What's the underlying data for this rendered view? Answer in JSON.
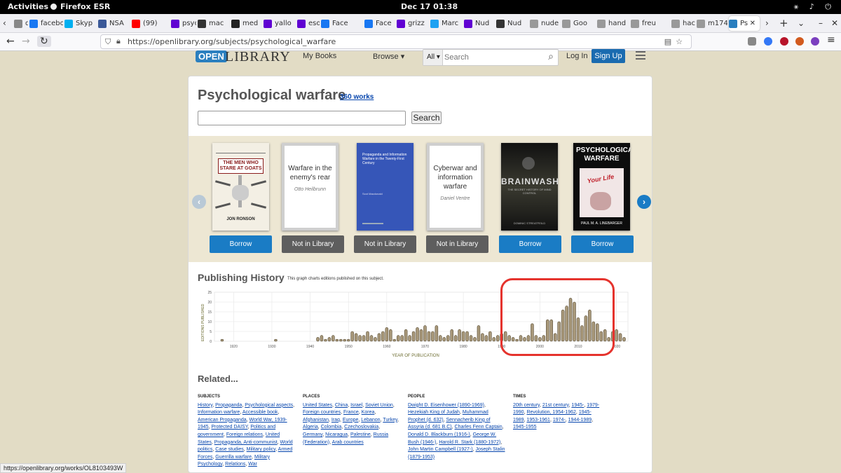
{
  "system": {
    "activities": "Activities",
    "app": "Firefox ESR",
    "clock": "Dec 17  01:38"
  },
  "tabs": [
    {
      "label": "dei",
      "color": "#888"
    },
    {
      "label": "faceboo",
      "color": "#1877f2"
    },
    {
      "label": "Skyp",
      "color": "#00aff0"
    },
    {
      "label": "NSA",
      "color": "#3b5998"
    },
    {
      "label": "(99)",
      "color": "#ff0000"
    },
    {
      "label": "psyc",
      "color": "#6001d2"
    },
    {
      "label": "mac",
      "color": "#333"
    },
    {
      "label": "med",
      "color": "#222"
    },
    {
      "label": "yallo",
      "color": "#6001d2"
    },
    {
      "label": "esot",
      "color": "#6001d2"
    },
    {
      "label": "Face",
      "color": "#1877f2"
    },
    {
      "label": "Face",
      "color": "#1877f2"
    },
    {
      "label": "grizz",
      "color": "#6001d2"
    },
    {
      "label": "Marc",
      "color": "#1da1f2"
    },
    {
      "label": "Nud",
      "color": "#6001d2"
    },
    {
      "label": "Nud",
      "color": "#333"
    },
    {
      "label": "nude",
      "color": "#999"
    },
    {
      "label": "Goo",
      "color": "#999"
    },
    {
      "label": "hand",
      "color": "#999"
    },
    {
      "label": "freu",
      "color": "#999"
    },
    {
      "label": "hack",
      "color": "#999"
    },
    {
      "label": "m174.jp",
      "color": "#999"
    },
    {
      "label": "Ps",
      "color": "#2a7fbf"
    }
  ],
  "url": "https://openlibrary.org/subjects/psychological_warfare",
  "site": {
    "logo_open": "OPEN",
    "logo_library": "LIBRARY",
    "my_books": "My Books",
    "browse": "Browse ▾",
    "search_scope": "All",
    "search_placeholder": "Search",
    "login": "Log In",
    "signup": "Sign Up"
  },
  "subject": {
    "title": "Psychological warfare",
    "works": "360 works",
    "search_button": "Search"
  },
  "carousel": [
    {
      "kind": "cover",
      "title": "THE MEN WHO STARE AT GOATS",
      "author": "JON RONSON",
      "button": "Borrow",
      "button_type": "borrow"
    },
    {
      "kind": "placeholder",
      "title": "Warfare in the enemy's rear",
      "author": "Otto Heilbrunn",
      "button": "Not in Library",
      "button_type": "not"
    },
    {
      "kind": "cover",
      "title": "Propaganda and Information Warfare in the Twenty-First Century",
      "author": "Scot Macdonald",
      "button": "Not in Library",
      "button_type": "not"
    },
    {
      "kind": "placeholder",
      "title": "Cyberwar and information warfare",
      "author": "Daniel Ventre",
      "button": "Not in Library",
      "button_type": "not"
    },
    {
      "kind": "cover",
      "title": "BRAINWASH",
      "subtitle": "THE SECRET HISTORY OF MIND CONTROL",
      "author": "DOMINIC STREATFEILD",
      "button": "Borrow",
      "button_type": "borrow"
    },
    {
      "kind": "cover",
      "title": "PSYCHOLOGICAL WARFARE",
      "author": "PAUL M. A. LINEBARGER",
      "button": "Borrow",
      "button_type": "borrow"
    }
  ],
  "publishing_history": {
    "title": "Publishing History",
    "description": "This graph charts editions published on this subject."
  },
  "chart_data": {
    "type": "bar",
    "ylabel": "EDITIONS PUBLISHED",
    "xlabel": "YEAR OF PUBLICATION",
    "ylim": [
      0,
      25
    ],
    "yticks": [
      0,
      5,
      10,
      15,
      20,
      25
    ],
    "xticks": [
      1920,
      1930,
      1940,
      1950,
      1960,
      1970,
      1980,
      1990,
      2000,
      2010,
      2020
    ],
    "x": [
      1917,
      1931,
      1942,
      1943,
      1944,
      1945,
      1946,
      1947,
      1948,
      1949,
      1950,
      1951,
      1952,
      1953,
      1954,
      1955,
      1956,
      1957,
      1958,
      1959,
      1960,
      1961,
      1962,
      1963,
      1964,
      1965,
      1966,
      1967,
      1968,
      1969,
      1970,
      1971,
      1972,
      1973,
      1974,
      1975,
      1976,
      1977,
      1978,
      1979,
      1980,
      1981,
      1982,
      1983,
      1984,
      1985,
      1986,
      1987,
      1988,
      1989,
      1990,
      1991,
      1992,
      1993,
      1994,
      1995,
      1996,
      1997,
      1998,
      1999,
      2000,
      2001,
      2002,
      2003,
      2004,
      2005,
      2006,
      2007,
      2008,
      2009,
      2010,
      2011,
      2012,
      2013,
      2014,
      2015,
      2016,
      2017,
      2018,
      2019,
      2020,
      2021,
      2022
    ],
    "values": [
      1,
      1,
      2,
      3,
      1,
      2,
      3,
      1,
      1,
      1,
      1,
      5,
      4,
      3,
      3,
      5,
      3,
      2,
      4,
      5,
      7,
      6,
      1,
      3,
      3,
      6,
      3,
      5,
      7,
      6,
      8,
      5,
      5,
      8,
      3,
      2,
      3,
      6,
      3,
      6,
      5,
      5,
      3,
      2,
      8,
      4,
      3,
      5,
      2,
      3,
      4,
      5,
      3,
      2,
      1,
      3,
      2,
      3,
      9,
      3,
      2,
      3,
      11,
      11,
      4,
      10,
      16,
      18,
      22,
      20,
      12,
      8,
      13,
      16,
      10,
      9,
      5,
      6,
      2,
      5,
      6,
      4,
      2
    ]
  },
  "related": {
    "title": "Related...",
    "subjects": {
      "heading": "SUBJECTS",
      "items": [
        "History",
        "Propaganda",
        "Psychological aspects",
        "Information warfare",
        "Accessible book",
        "American Propaganda",
        "World War, 1939-1945",
        "Protected DAISY",
        "Politics and government",
        "Foreign relations",
        "United States",
        "Propaganda, Anti-communist",
        "World politics",
        "Case studies",
        "Military policy",
        "Armed Forces",
        "Guerrilla warfare",
        "Military Psychology",
        "Relations",
        "War"
      ]
    },
    "places": {
      "heading": "PLACES",
      "items": [
        "United States",
        "China",
        "Israel",
        "Soviet Union",
        "Foreign countries",
        "France",
        "Korea",
        "Afghanistan",
        "Iraq",
        "Europe",
        "Lebanon",
        "Turkey",
        "Algeria",
        "Colombia",
        "Czechoslovakia",
        "Germany",
        "Nicaragua",
        "Palestine",
        "Russia (Federation)",
        "Arab countries"
      ]
    },
    "people": {
      "heading": "PEOPLE",
      "items": [
        "Dwight D. Eisenhower (1890-1969)",
        "Hezekiah King of Judah",
        "Muhammad Prophet (d. 632)",
        "Sennacherib King of Assyria (d. 681 B.C)",
        "Charles Fenn Captain",
        "Donald D. Blackburn (1916-)",
        "George W. Bush (1946-)",
        "Harold R. Stark (1880-1972)",
        "John Martin Campbell (1927-)",
        "Joseph Stalin (1879-1953)"
      ]
    },
    "times": {
      "heading": "TIMES",
      "items": [
        "20th century",
        "21st century",
        "1945-",
        "1979-1990",
        "Revolution, 1954-1962",
        "1945-1989",
        "1953-1961",
        "1974-",
        "1944-1989",
        "1945-1955"
      ]
    }
  },
  "status_url": "https://openlibrary.org/works/OL8103493W"
}
